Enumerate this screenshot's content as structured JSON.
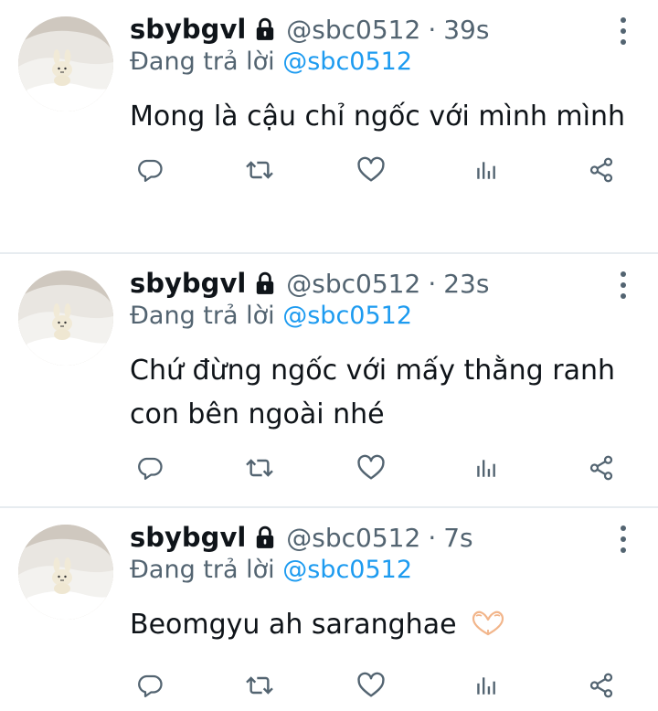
{
  "tweets": [
    {
      "display_name": "sbybgvl",
      "handle": "@sbc0512",
      "separator": "·",
      "time": "39s",
      "replying_prefix": "Đang trả lời",
      "replying_to": "@sbc0512",
      "text": "Mong là cậu chỉ ngốc với mình mình",
      "locked": true
    },
    {
      "display_name": "sbybgvl",
      "handle": "@sbc0512",
      "separator": "·",
      "time": "23s",
      "replying_prefix": "Đang trả lời",
      "replying_to": "@sbc0512",
      "text": "Chứ đừng ngốc với mấy thằng ranh con bên ngoài nhé",
      "locked": true
    },
    {
      "display_name": "sbybgvl",
      "handle": "@sbc0512",
      "separator": "·",
      "time": "7s",
      "replying_prefix": "Đang trả lời",
      "replying_to": "@sbc0512",
      "text": "Beomgyu ah saranghae",
      "emoji": "heart-hands",
      "locked": true
    }
  ],
  "icons": {
    "lock": "lock-icon",
    "more": "more-vertical-icon",
    "reply": "reply-icon",
    "retweet": "retweet-icon",
    "like": "heart-icon",
    "views": "views-bar-chart-icon",
    "share": "share-icon"
  },
  "colors": {
    "text": "#0f1419",
    "secondary": "#536471",
    "link": "#1d9bf0",
    "divider": "#e7ecf0"
  }
}
